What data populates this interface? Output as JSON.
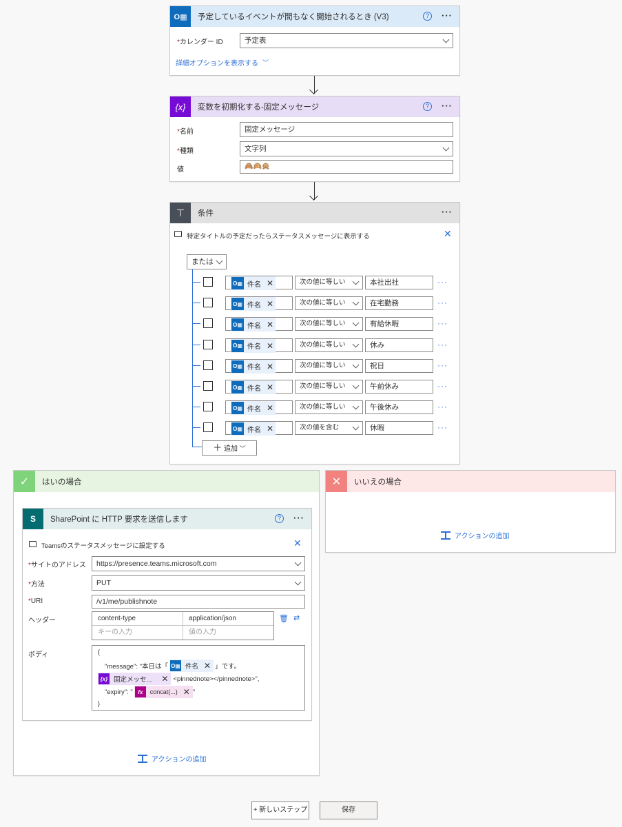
{
  "trigger": {
    "title": "予定しているイベントが間もなく開始されるとき (V3)",
    "help": "?",
    "more": "···",
    "calendar_label": "カレンダー ID",
    "calendar_value": "予定表",
    "advanced_link": "詳細オプションを表示する"
  },
  "init_var": {
    "title": "変数を初期化する-固定メッセージ",
    "icon": "{x}",
    "name_label": "名前",
    "name_value": "固定メッセージ",
    "type_label": "種類",
    "type_value": "文字列",
    "value_label": "値",
    "value_emoji": "🙈🙉🙊"
  },
  "condition": {
    "title": "条件",
    "comment": "特定タイトルの予定だったらステータスメッセージに表示する",
    "group_op": "または",
    "add_label": "追加",
    "rows": [
      {
        "token": "件名",
        "op": "次の値に等しい",
        "value": "本社出社"
      },
      {
        "token": "件名",
        "op": "次の値に等しい",
        "value": "在宅勤務"
      },
      {
        "token": "件名",
        "op": "次の値に等しい",
        "value": "有給休暇"
      },
      {
        "token": "件名",
        "op": "次の値に等しい",
        "value": "休み"
      },
      {
        "token": "件名",
        "op": "次の値に等しい",
        "value": "祝日"
      },
      {
        "token": "件名",
        "op": "次の値に等しい",
        "value": "午前休み"
      },
      {
        "token": "件名",
        "op": "次の値に等しい",
        "value": "午後休み"
      },
      {
        "token": "件名",
        "op": "次の値を含む",
        "value": "休暇"
      }
    ]
  },
  "yes_branch": {
    "title": "はいの場合",
    "add_action": "アクションの追加"
  },
  "no_branch": {
    "title": "いいえの場合",
    "add_action": "アクションの追加"
  },
  "sharepoint": {
    "title": "SharePoint に HTTP 要求を送信します",
    "comment": "Teamsのステータスメッセージに設定する",
    "site_label": "サイトのアドレス",
    "site_value": "https://presence.teams.microsoft.com",
    "method_label": "方法",
    "method_value": "PUT",
    "uri_label": "URI",
    "uri_value": "/v1/me/publishnote",
    "headers_label": "ヘッダー",
    "header_key": "content-type",
    "header_value": "application/json",
    "key_placeholder": "キーの入力",
    "value_placeholder": "値の入力",
    "body_label": "ボディ",
    "body_open": "{",
    "body_line1_prefix": "\"message\": \"本日は「",
    "body_token1": "件名",
    "body_line1_suffix": "」です。",
    "body_token2": "固定メッセ...",
    "body_line2_suffix": "<pinnednote></pinnednote>\",",
    "body_line3_prefix": "\"expiry\": \"",
    "body_token3": "concat(...)",
    "body_line3_suffix": "\"",
    "body_close": "}"
  },
  "footer": {
    "new_step": "+ 新しいステップ",
    "save": "保存"
  },
  "colors": {
    "trigger_head": "#dbeaf8",
    "var_head": "#e8ddf6",
    "cond_head": "#e1e1e1",
    "yes_head": "#e6f4e1",
    "no_head": "#fde7e7",
    "sp_head": "#e2eeee"
  }
}
